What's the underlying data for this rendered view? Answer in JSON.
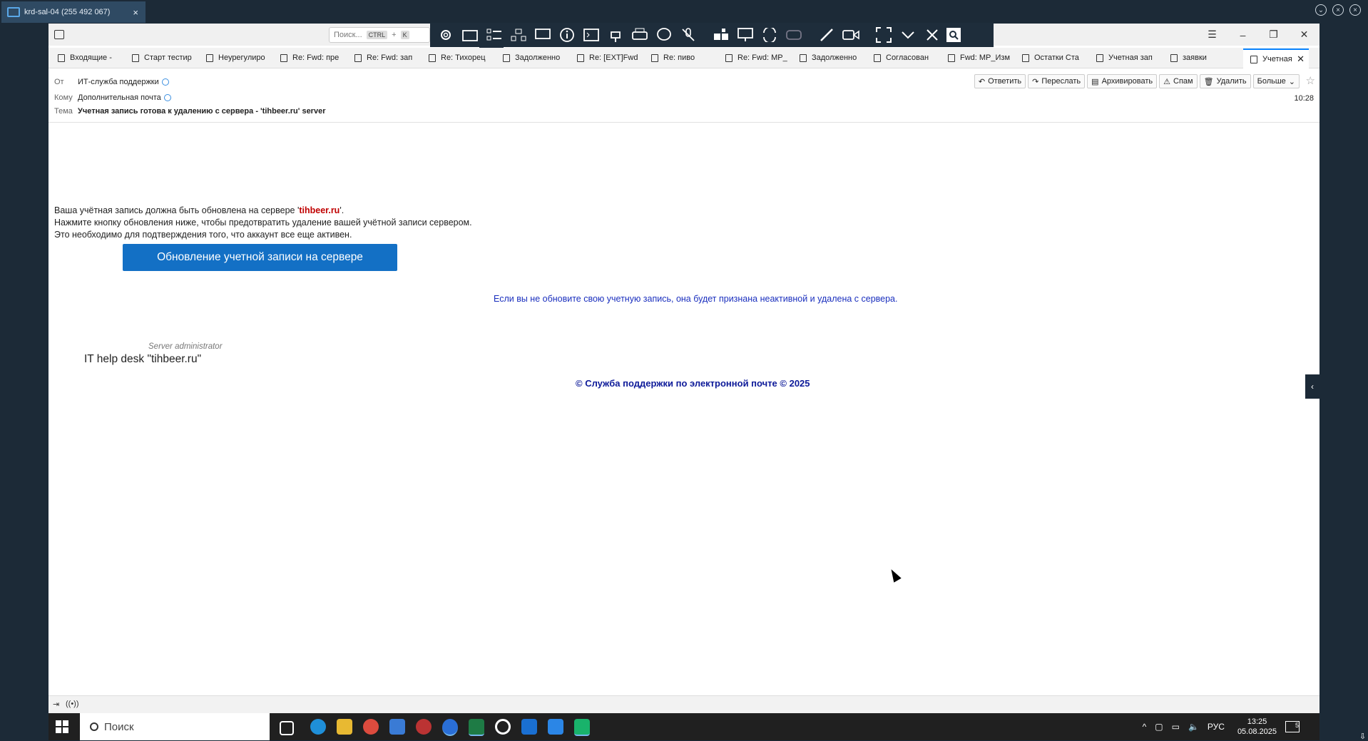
{
  "remote": {
    "tab_title": "krd-sal-04 (255 492 067)",
    "close": "×"
  },
  "app": {
    "search_placeholder": "Поиск...",
    "search_kbd": "CTRL",
    "search_plus": "+",
    "search_key": "K",
    "min": "–",
    "max": "❐",
    "close": "✕"
  },
  "tabs": [
    {
      "label": "Входящие -"
    },
    {
      "label": "Старт тестир"
    },
    {
      "label": "Неурегулиро"
    },
    {
      "label": "Re: Fwd: пре"
    },
    {
      "label": "Re: Fwd: зап"
    },
    {
      "label": "Re: Тихорец"
    },
    {
      "label": "Задолженно"
    },
    {
      "label": "Re: [EXT]Fwd"
    },
    {
      "label": "Re: пиво"
    },
    {
      "label": "Re: Fwd: MP_"
    },
    {
      "label": "Задолженно"
    },
    {
      "label": "Согласован"
    },
    {
      "label": "Fwd: MP_Изм"
    },
    {
      "label": "Остатки Ста"
    },
    {
      "label": "Учетная зап"
    },
    {
      "label": "заявки"
    },
    {
      "label": "Учетная"
    }
  ],
  "header": {
    "from_label": "От",
    "from_value": "ИТ-служба поддержки",
    "to_label": "Кому",
    "to_value": "Дополнительная почта",
    "subject_label": "Тема",
    "subject_value": "Учетная запись готова к удалению с сервера - 'tihbeer.ru' server",
    "time": "10:28",
    "actions": {
      "reply": "Ответить",
      "forward": "Переслать",
      "archive": "Архивировать",
      "spam": "Спам",
      "delete": "Удалить",
      "more": "Больше"
    }
  },
  "message": {
    "line1_a": "Ваша учётная запись должна быть обновлена на сервере '",
    "line1_domain": "tihbeer.ru",
    "line1_b": "'.",
    "line2": "Нажмите кнопку обновления ниже, чтобы предотвратить удаление вашей учётной записи сервером.",
    "line3": "Это необходимо для подтверждения того, что аккаунт все еще активен.",
    "button": "Обновление учетной записи на сервере",
    "warning": "Если вы не обновите свою учетную запись, она будет признана неактивной и удалена с сервера.",
    "signature_role": "Server administrator",
    "signature_name": "IT help desk \"tihbeer.ru\"",
    "footer": "© Служба поддержки по электронной почте © 2025"
  },
  "taskbar": {
    "search": "Поиск",
    "lang": "РУС",
    "time": "13:25",
    "date": "05.08.2025",
    "notifications": "5"
  },
  "icons": {
    "remote_toolbar": [
      "gear-icon",
      "folder-icon",
      "list-icon",
      "network-icon",
      "screens-icon",
      "info-icon",
      "terminal-icon",
      "plug-icon",
      "print-icon",
      "chat-icon",
      "mute-mic-icon",
      "apps-icon",
      "presentation-icon",
      "switch-icon",
      "gamepad-icon",
      "pen-icon",
      "video-icon",
      "fullscreen-icon",
      "chevron-down-icon",
      "close-icon"
    ]
  }
}
